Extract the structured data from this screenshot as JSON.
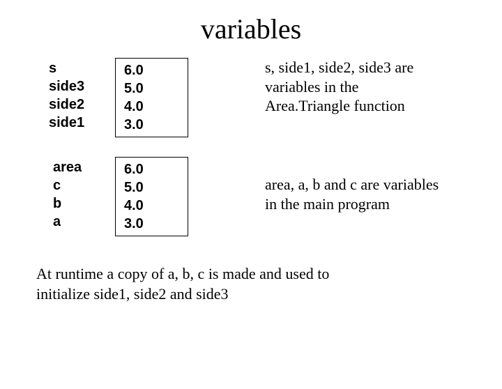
{
  "title": "variables",
  "block1": {
    "names": [
      "s",
      "side3",
      "side2",
      "side1"
    ],
    "values": [
      "6.0",
      "5.0",
      "4.0",
      "3.0"
    ],
    "desc": "s, side1, side2, side3 are variables in the Area.Triangle function"
  },
  "block2": {
    "names": [
      "area",
      "c",
      "b",
      "a"
    ],
    "values": [
      "6.0",
      "5.0",
      "4.0",
      "3.0"
    ],
    "desc": "area, a, b and c  are variables in the main program"
  },
  "footer": "At runtime a copy of a, b, c is made and used to initialize side1, side2 and side3"
}
